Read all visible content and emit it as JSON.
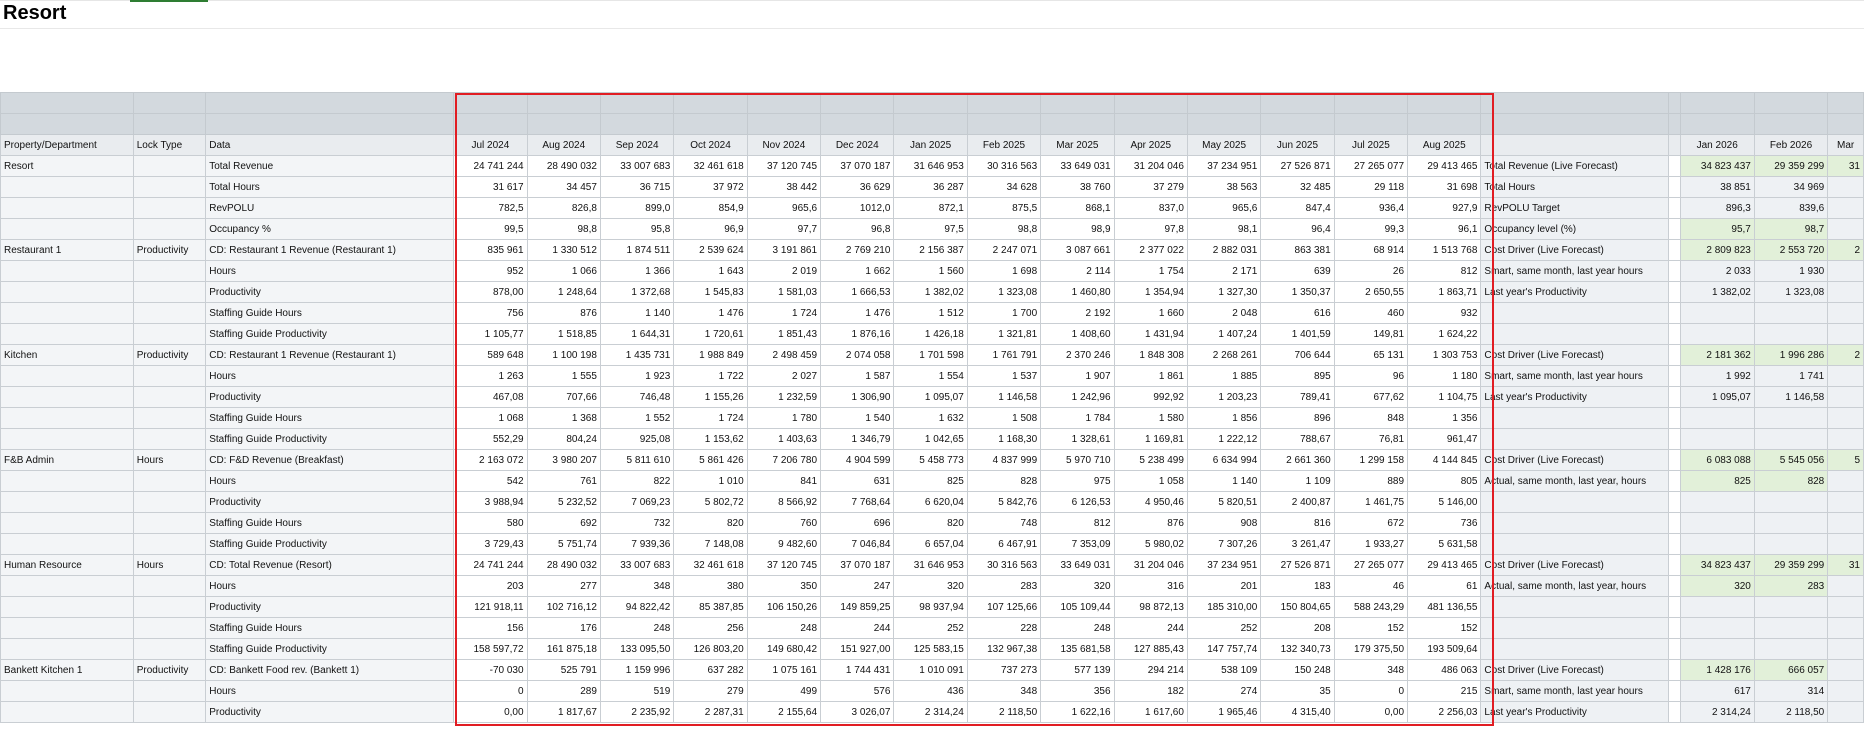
{
  "page": {
    "title": "Resort"
  },
  "columns": {
    "property": "Property/Department",
    "lock": "Lock Type",
    "data": "Data",
    "months": [
      "Jul 2024",
      "Aug 2024",
      "Sep 2024",
      "Oct 2024",
      "Nov 2024",
      "Dec 2024",
      "Jan 2025",
      "Feb 2025",
      "Mar 2025",
      "Apr 2025",
      "May 2025",
      "Jun 2025",
      "Jul 2025",
      "Aug 2025"
    ],
    "ext_months": [
      "Jan 2026",
      "Feb 2026",
      "Mar"
    ]
  },
  "highlight_color": "#e11d23",
  "rows": [
    {
      "prop": "Resort",
      "lock": "",
      "data": "Total Revenue",
      "vals": [
        "24 741 244",
        "28 490 032",
        "33 007 683",
        "32 461 618",
        "37 120 745",
        "37 070 187",
        "31 646 953",
        "30 316 563",
        "33 649 031",
        "31 204 046",
        "37 234 951",
        "27 526 871",
        "27 265 077",
        "29 413 465"
      ],
      "ext": "Total Revenue (Live Forecast)",
      "e1": "34 823 437",
      "e2": "29 359 299",
      "e3": "31",
      "green": true
    },
    {
      "prop": "",
      "lock": "",
      "data": "Total Hours",
      "vals": [
        "31 617",
        "34 457",
        "36 715",
        "37 972",
        "38 442",
        "36 629",
        "36 287",
        "34 628",
        "38 760",
        "37 279",
        "38 563",
        "32 485",
        "29 118",
        "31 698"
      ],
      "ext": "Total Hours",
      "e1": "38 851",
      "e2": "34 969",
      "e3": "",
      "green": false
    },
    {
      "prop": "",
      "lock": "",
      "data": "RevPOLU",
      "vals": [
        "782,5",
        "826,8",
        "899,0",
        "854,9",
        "965,6",
        "1012,0",
        "872,1",
        "875,5",
        "868,1",
        "837,0",
        "965,6",
        "847,4",
        "936,4",
        "927,9"
      ],
      "ext": "RevPOLU Target",
      "e1": "896,3",
      "e2": "839,6",
      "e3": "",
      "green": false
    },
    {
      "prop": "",
      "lock": "",
      "data": "Occupancy %",
      "vals": [
        "99,5",
        "98,8",
        "95,8",
        "96,9",
        "97,7",
        "96,8",
        "97,5",
        "98,8",
        "98,9",
        "97,8",
        "98,1",
        "96,4",
        "99,3",
        "96,1"
      ],
      "ext": "Occupancy level (%)",
      "e1": "95,7",
      "e2": "98,7",
      "e3": "",
      "green": true
    },
    {
      "prop": "Restaurant 1",
      "lock": "Productivity",
      "data": "CD: Restaurant 1 Revenue (Restaurant 1)",
      "vals": [
        "835 961",
        "1 330 512",
        "1 874 511",
        "2 539 624",
        "3 191 861",
        "2 769 210",
        "2 156 387",
        "2 247 071",
        "3 087 661",
        "2 377 022",
        "2 882 031",
        "863 381",
        "68 914",
        "1 513 768"
      ],
      "ext": "Cost Driver (Live Forecast)",
      "e1": "2 809 823",
      "e2": "2 553 720",
      "e3": "2",
      "green": true
    },
    {
      "prop": "",
      "lock": "",
      "data": "Hours",
      "vals": [
        "952",
        "1 066",
        "1 366",
        "1 643",
        "2 019",
        "1 662",
        "1 560",
        "1 698",
        "2 114",
        "1 754",
        "2 171",
        "639",
        "26",
        "812"
      ],
      "ext": "Smart, same month, last year hours",
      "e1": "2 033",
      "e2": "1 930",
      "e3": "",
      "green": false
    },
    {
      "prop": "",
      "lock": "",
      "data": "Productivity",
      "vals": [
        "878,00",
        "1 248,64",
        "1 372,68",
        "1 545,83",
        "1 581,03",
        "1 666,53",
        "1 382,02",
        "1 323,08",
        "1 460,80",
        "1 354,94",
        "1 327,30",
        "1 350,37",
        "2 650,55",
        "1 863,71"
      ],
      "ext": "Last year's Productivity",
      "e1": "1 382,02",
      "e2": "1 323,08",
      "e3": "",
      "green": false
    },
    {
      "prop": "",
      "lock": "",
      "data": "Staffing Guide Hours",
      "vals": [
        "756",
        "876",
        "1 140",
        "1 476",
        "1 724",
        "1 476",
        "1 512",
        "1 700",
        "2 192",
        "1 660",
        "2 048",
        "616",
        "460",
        "932"
      ],
      "ext": "",
      "e1": "",
      "e2": "",
      "e3": "",
      "green": false
    },
    {
      "prop": "",
      "lock": "",
      "data": "Staffing Guide Productivity",
      "vals": [
        "1 105,77",
        "1 518,85",
        "1 644,31",
        "1 720,61",
        "1 851,43",
        "1 876,16",
        "1 426,18",
        "1 321,81",
        "1 408,60",
        "1 431,94",
        "1 407,24",
        "1 401,59",
        "149,81",
        "1 624,22"
      ],
      "ext": "",
      "e1": "",
      "e2": "",
      "e3": "",
      "green": false
    },
    {
      "prop": "Kitchen",
      "lock": "Productivity",
      "data": "CD: Restaurant 1 Revenue (Restaurant 1)",
      "vals": [
        "589 648",
        "1 100 198",
        "1 435 731",
        "1 988 849",
        "2 498 459",
        "2 074 058",
        "1 701 598",
        "1 761 791",
        "2 370 246",
        "1 848 308",
        "2 268 261",
        "706 644",
        "65 131",
        "1 303 753"
      ],
      "ext": "Cost Driver (Live Forecast)",
      "e1": "2 181 362",
      "e2": "1 996 286",
      "e3": "2",
      "green": true
    },
    {
      "prop": "",
      "lock": "",
      "data": "Hours",
      "vals": [
        "1 263",
        "1 555",
        "1 923",
        "1 722",
        "2 027",
        "1 587",
        "1 554",
        "1 537",
        "1 907",
        "1 861",
        "1 885",
        "895",
        "96",
        "1 180"
      ],
      "ext": "Smart, same month, last year hours",
      "e1": "1 992",
      "e2": "1 741",
      "e3": "",
      "green": false
    },
    {
      "prop": "",
      "lock": "",
      "data": "Productivity",
      "vals": [
        "467,08",
        "707,66",
        "746,48",
        "1 155,26",
        "1 232,59",
        "1 306,90",
        "1 095,07",
        "1 146,58",
        "1 242,96",
        "992,92",
        "1 203,23",
        "789,41",
        "677,62",
        "1 104,75"
      ],
      "ext": "Last year's Productivity",
      "e1": "1 095,07",
      "e2": "1 146,58",
      "e3": "",
      "green": false
    },
    {
      "prop": "",
      "lock": "",
      "data": "Staffing Guide Hours",
      "vals": [
        "1 068",
        "1 368",
        "1 552",
        "1 724",
        "1 780",
        "1 540",
        "1 632",
        "1 508",
        "1 784",
        "1 580",
        "1 856",
        "896",
        "848",
        "1 356"
      ],
      "ext": "",
      "e1": "",
      "e2": "",
      "e3": "",
      "green": false
    },
    {
      "prop": "",
      "lock": "",
      "data": "Staffing Guide Productivity",
      "vals": [
        "552,29",
        "804,24",
        "925,08",
        "1 153,62",
        "1 403,63",
        "1 346,79",
        "1 042,65",
        "1 168,30",
        "1 328,61",
        "1 169,81",
        "1 222,12",
        "788,67",
        "76,81",
        "961,47"
      ],
      "ext": "",
      "e1": "",
      "e2": "",
      "e3": "",
      "green": false
    },
    {
      "prop": "F&B Admin",
      "lock": "Hours",
      "data": "CD: F&D Revenue (Breakfast)",
      "vals": [
        "2 163 072",
        "3 980 207",
        "5 811 610",
        "5 861 426",
        "7 206 780",
        "4 904 599",
        "5 458 773",
        "4 837 999",
        "5 970 710",
        "5 238 499",
        "6 634 994",
        "2 661 360",
        "1 299 158",
        "4 144 845"
      ],
      "ext": "Cost Driver (Live Forecast)",
      "e1": "6 083 088",
      "e2": "5 545 056",
      "e3": "5",
      "green": true
    },
    {
      "prop": "",
      "lock": "",
      "data": "Hours",
      "vals": [
        "542",
        "761",
        "822",
        "1 010",
        "841",
        "631",
        "825",
        "828",
        "975",
        "1 058",
        "1 140",
        "1 109",
        "889",
        "805"
      ],
      "ext": "Actual, same month, last year, hours",
      "e1": "825",
      "e2": "828",
      "e3": "",
      "green": true
    },
    {
      "prop": "",
      "lock": "",
      "data": "Productivity",
      "vals": [
        "3 988,94",
        "5 232,52",
        "7 069,23",
        "5 802,72",
        "8 566,92",
        "7 768,64",
        "6 620,04",
        "5 842,76",
        "6 126,53",
        "4 950,46",
        "5 820,51",
        "2 400,87",
        "1 461,75",
        "5 146,00"
      ],
      "ext": "",
      "e1": "",
      "e2": "",
      "e3": "",
      "green": false
    },
    {
      "prop": "",
      "lock": "",
      "data": "Staffing Guide Hours",
      "vals": [
        "580",
        "692",
        "732",
        "820",
        "760",
        "696",
        "820",
        "748",
        "812",
        "876",
        "908",
        "816",
        "672",
        "736"
      ],
      "ext": "",
      "e1": "",
      "e2": "",
      "e3": "",
      "green": false
    },
    {
      "prop": "",
      "lock": "",
      "data": "Staffing Guide Productivity",
      "vals": [
        "3 729,43",
        "5 751,74",
        "7 939,36",
        "7 148,08",
        "9 482,60",
        "7 046,84",
        "6 657,04",
        "6 467,91",
        "7 353,09",
        "5 980,02",
        "7 307,26",
        "3 261,47",
        "1 933,27",
        "5 631,58"
      ],
      "ext": "",
      "e1": "",
      "e2": "",
      "e3": "",
      "green": false
    },
    {
      "prop": "Human Resource",
      "lock": "Hours",
      "data": "CD: Total Revenue (Resort)",
      "vals": [
        "24 741 244",
        "28 490 032",
        "33 007 683",
        "32 461 618",
        "37 120 745",
        "37 070 187",
        "31 646 953",
        "30 316 563",
        "33 649 031",
        "31 204 046",
        "37 234 951",
        "27 526 871",
        "27 265 077",
        "29 413 465"
      ],
      "ext": "Cost Driver (Live Forecast)",
      "e1": "34 823 437",
      "e2": "29 359 299",
      "e3": "31",
      "green": true
    },
    {
      "prop": "",
      "lock": "",
      "data": "Hours",
      "vals": [
        "203",
        "277",
        "348",
        "380",
        "350",
        "247",
        "320",
        "283",
        "320",
        "316",
        "201",
        "183",
        "46",
        "61"
      ],
      "ext": "Actual, same month, last year, hours",
      "e1": "320",
      "e2": "283",
      "e3": "",
      "green": true
    },
    {
      "prop": "",
      "lock": "",
      "data": "Productivity",
      "vals": [
        "121 918,11",
        "102 716,12",
        "94 822,42",
        "85 387,85",
        "106 150,26",
        "149 859,25",
        "98 937,94",
        "107 125,66",
        "105 109,44",
        "98 872,13",
        "185 310,00",
        "150 804,65",
        "588 243,29",
        "481 136,55"
      ],
      "ext": "",
      "e1": "",
      "e2": "",
      "e3": "",
      "green": false
    },
    {
      "prop": "",
      "lock": "",
      "data": "Staffing Guide Hours",
      "vals": [
        "156",
        "176",
        "248",
        "256",
        "248",
        "244",
        "252",
        "228",
        "248",
        "244",
        "252",
        "208",
        "152",
        "152"
      ],
      "ext": "",
      "e1": "",
      "e2": "",
      "e3": "",
      "green": false
    },
    {
      "prop": "",
      "lock": "",
      "data": "Staffing Guide Productivity",
      "vals": [
        "158 597,72",
        "161 875,18",
        "133 095,50",
        "126 803,20",
        "149 680,42",
        "151 927,00",
        "125 583,15",
        "132 967,38",
        "135 681,58",
        "127 885,43",
        "147 757,74",
        "132 340,73",
        "179 375,50",
        "193 509,64"
      ],
      "ext": "",
      "e1": "",
      "e2": "",
      "e3": "",
      "green": false
    },
    {
      "prop": "Bankett Kitchen 1",
      "lock": "Productivity",
      "data": "CD: Bankett Food rev. (Bankett 1)",
      "vals": [
        "-70 030",
        "525 791",
        "1 159 996",
        "637 282",
        "1 075 161",
        "1 744 431",
        "1 010 091",
        "737 273",
        "577 139",
        "294 214",
        "538 109",
        "150 248",
        "348",
        "486 063"
      ],
      "ext": "Cost Driver (Live Forecast)",
      "e1": "1 428 176",
      "e2": "666 057",
      "e3": "",
      "green": true
    },
    {
      "prop": "",
      "lock": "",
      "data": "Hours",
      "vals": [
        "0",
        "289",
        "519",
        "279",
        "499",
        "576",
        "436",
        "348",
        "356",
        "182",
        "274",
        "35",
        "0",
        "215"
      ],
      "ext": "Smart, same month, last year hours",
      "e1": "617",
      "e2": "314",
      "e3": "",
      "green": false
    },
    {
      "prop": "",
      "lock": "",
      "data": "Productivity",
      "vals": [
        "0,00",
        "1 817,67",
        "2 235,92",
        "2 287,31",
        "2 155,64",
        "3 026,07",
        "2 314,24",
        "2 118,50",
        "1 622,16",
        "1 617,60",
        "1 965,46",
        "4 315,40",
        "0,00",
        "2 256,03"
      ],
      "ext": "Last year's Productivity",
      "e1": "2 314,24",
      "e2": "2 118,50",
      "e3": "",
      "green": false
    }
  ]
}
